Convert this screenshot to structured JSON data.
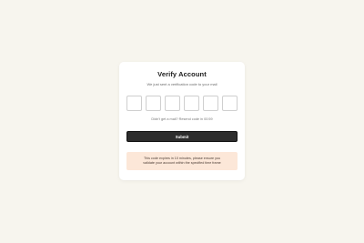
{
  "card": {
    "title": "Verify Account",
    "subtitle": "We just sent a verification code to your mail",
    "code_digits": [
      "",
      "",
      "",
      "",
      "",
      ""
    ],
    "resend_text": "Didn't get a mail? Resend code in 00:59",
    "submit_label": "Submit",
    "notice_line1": "This code expires in 10 minutes, please ensure you",
    "notice_line2": "validate your account within the specified time frame"
  },
  "colors": {
    "page_background": "#f7f5ee",
    "button_background": "#2d2d2d",
    "notice_background": "#fce7d8"
  }
}
